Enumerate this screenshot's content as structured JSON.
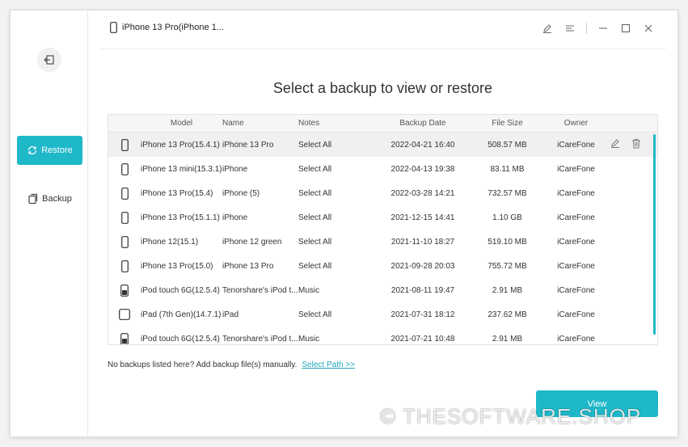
{
  "window": {
    "device_title": "iPhone 13 Pro(iPhone 1..."
  },
  "sidebar": {
    "restore_label": "Restore",
    "backup_label": "Backup"
  },
  "main": {
    "heading": "Select a backup to view or restore",
    "columns": [
      "Model",
      "Name",
      "Notes",
      "Backup Date",
      "File Size",
      "Owner"
    ],
    "rows": [
      {
        "icon": "iphone-icon",
        "model": "iPhone 13 Pro(15.4.1)",
        "name": "iPhone 13 Pro",
        "notes": "Select All",
        "date": "2022-04-21 16:40",
        "size": "508.57 MB",
        "owner": "iCareFone"
      },
      {
        "icon": "iphone-icon",
        "model": "iPhone 13 mini(15.3.1)",
        "name": "iPhone",
        "notes": "Select All",
        "date": "2022-04-13 19:38",
        "size": "83.11 MB",
        "owner": "iCareFone"
      },
      {
        "icon": "iphone-icon",
        "model": "iPhone 13 Pro(15.4)",
        "name": "iPhone (5)",
        "notes": "Select All",
        "date": "2022-03-28 14:21",
        "size": "732.57 MB",
        "owner": "iCareFone"
      },
      {
        "icon": "iphone-icon",
        "model": "iPhone 13 Pro(15.1.1)",
        "name": "iPhone",
        "notes": "Select All",
        "date": "2021-12-15 14:41",
        "size": "1.10 GB",
        "owner": "iCareFone"
      },
      {
        "icon": "iphone-icon",
        "model": "iPhone 12(15.1)",
        "name": "iPhone 12 green",
        "notes": "Select All",
        "date": "2021-11-10 18:27",
        "size": "519.10 MB",
        "owner": "iCareFone"
      },
      {
        "icon": "iphone-icon",
        "model": "iPhone 13 Pro(15.0)",
        "name": "iPhone 13 Pro",
        "notes": "Select All",
        "date": "2021-09-28 20:03",
        "size": "755.72 MB",
        "owner": "iCareFone"
      },
      {
        "icon": "ipod-icon",
        "model": "iPod touch 6G(12.5.4)",
        "name": "Tenorshare's iPod t...",
        "notes": "Music",
        "date": "2021-08-11 19:47",
        "size": "2.91 MB",
        "owner": "iCareFone"
      },
      {
        "icon": "ipad-icon",
        "model": "iPad (7th Gen)(14.7.1)",
        "name": "iPad",
        "notes": "Select All",
        "date": "2021-07-31 18:12",
        "size": "237.62 MB",
        "owner": "iCareFone"
      },
      {
        "icon": "ipod-icon",
        "model": "iPod touch 6G(12.5.4)",
        "name": "Tenorshare's iPod t...",
        "notes": "Music",
        "date": "2021-07-21 10:48",
        "size": "2.91 MB",
        "owner": "iCareFone"
      }
    ]
  },
  "footer": {
    "hint": "No backups listed here? Add backup file(s) manually.",
    "select_path": "Select Path >>",
    "view_label": "View"
  },
  "watermark": "© THESOFTWARE.SHOP",
  "colors": {
    "accent": "#1fb8c9"
  }
}
